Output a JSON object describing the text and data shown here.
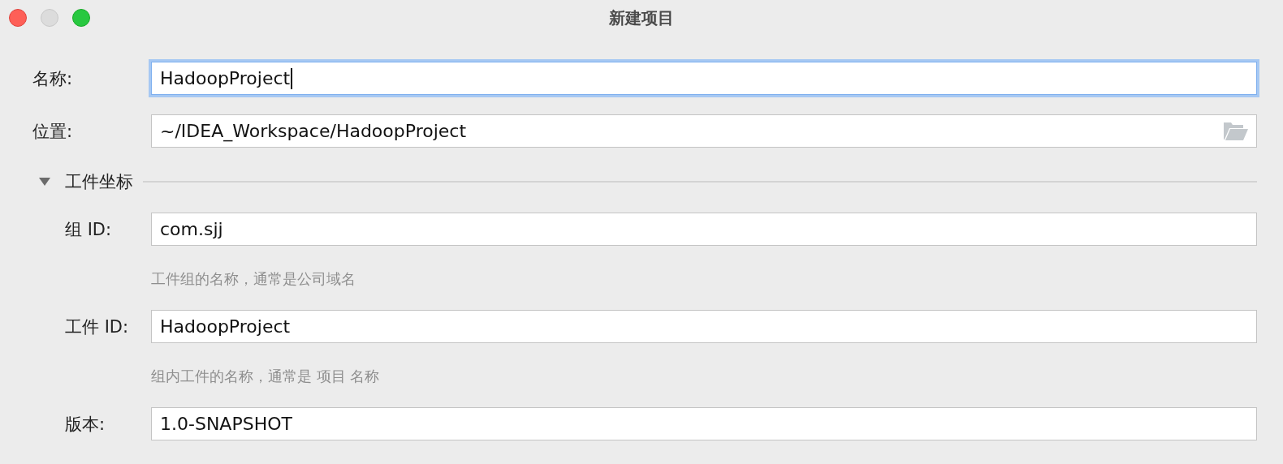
{
  "window": {
    "title": "新建项目"
  },
  "fields": [
    {
      "label": "名称:",
      "value": "HadoopProject",
      "focused": true,
      "kind": "text"
    },
    {
      "label": "位置:",
      "value": "~/IDEA_Workspace/HadoopProject",
      "focused": false,
      "kind": "folder"
    }
  ],
  "section": {
    "title": "工件坐标",
    "expanded": true,
    "fields": [
      {
        "label": "组 ID:",
        "value": "com.sjj",
        "focused": false,
        "hint": "工件组的名称，通常是公司域名"
      },
      {
        "label": "工件 ID:",
        "value": "HadoopProject",
        "focused": false,
        "hint": "组内工件的名称，通常是 项目 名称"
      },
      {
        "label": "版本:",
        "value": "1.0-SNAPSHOT",
        "focused": false
      }
    ]
  }
}
